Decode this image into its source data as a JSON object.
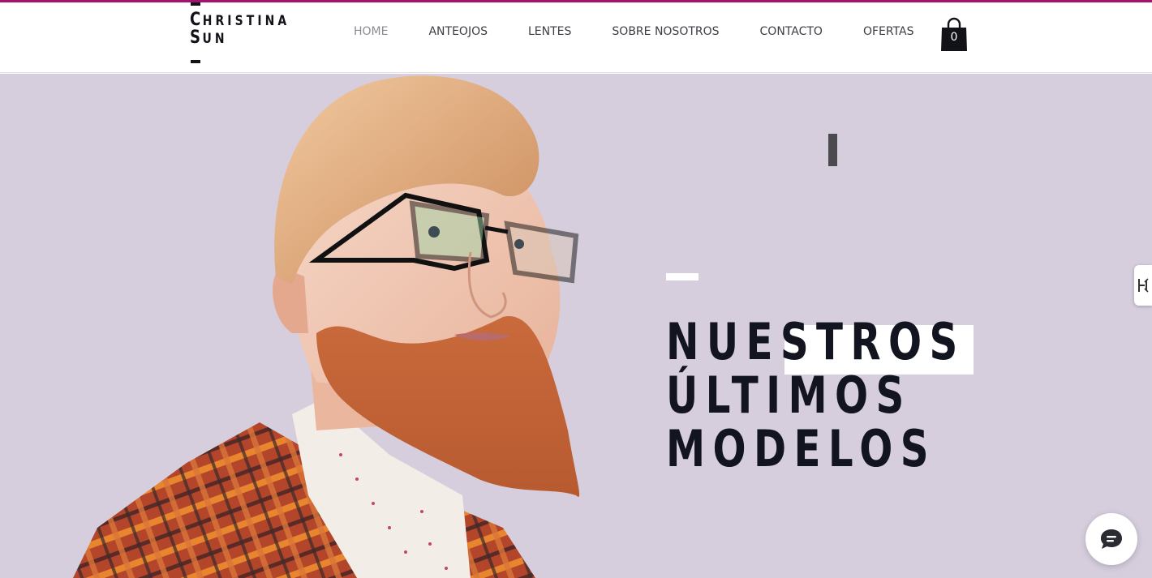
{
  "brand": {
    "name_line1_initial": "C",
    "name_line1_rest": "HRISTINA",
    "name_line2_initial": "S",
    "name_line2_rest": "UN"
  },
  "colors": {
    "accent": "#a0136f",
    "hero_background": "#d6cddd",
    "text_dark": "#121520"
  },
  "nav": {
    "items": [
      {
        "label": "HOME",
        "active": true
      },
      {
        "label": "ANTEOJOS",
        "active": false
      },
      {
        "label": "LENTES",
        "active": false
      },
      {
        "label": "SOBRE NOSOTROS",
        "active": false
      },
      {
        "label": "CONTACTO",
        "active": false
      },
      {
        "label": "OFERTAS",
        "active": false
      }
    ]
  },
  "cart": {
    "icon": "shopping-bag-icon",
    "count": "0"
  },
  "hero": {
    "title_lines": [
      "NUESTROS",
      "ÚLTIMOS",
      "MODELOS"
    ],
    "image": "man-with-glasses-photo"
  },
  "widgets": {
    "side_tab_icon": "accessibility-icon",
    "chat_icon": "chat-bubble-icon"
  }
}
